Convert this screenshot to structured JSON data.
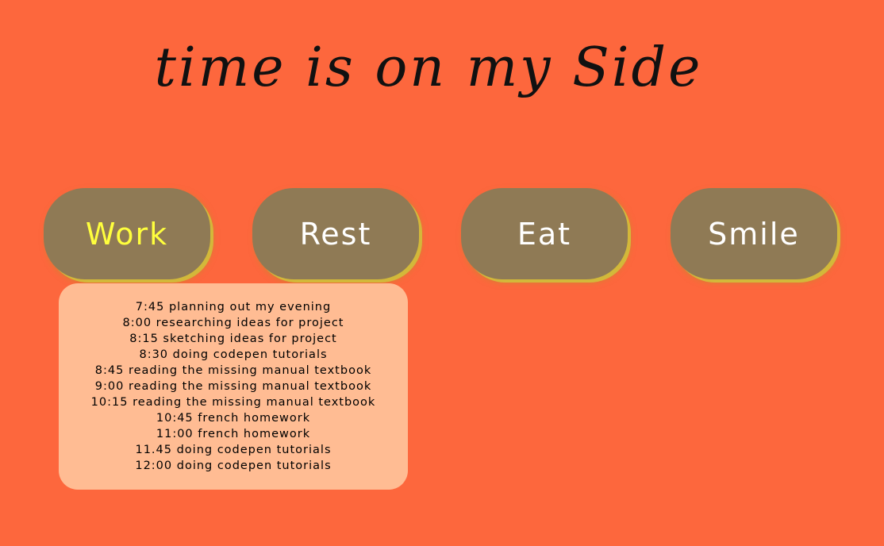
{
  "title": "time is on my Side",
  "tabs": [
    {
      "label": "Work",
      "active": true
    },
    {
      "label": "Rest",
      "active": false
    },
    {
      "label": "Eat",
      "active": false
    },
    {
      "label": "Smile",
      "active": false
    }
  ],
  "schedule": [
    "7:45 planning out my evening",
    "8:00 researching ideas for project",
    "8:15 sketching ideas for project",
    "8:30 doing codepen tutorials",
    "8:45 reading the missing manual textbook",
    "9:00 reading the missing manual textbook",
    "10:15 reading the missing manual textbook",
    "10:45 french homework",
    "11:00 french homework",
    "11.45 doing codepen tutorials",
    "12:00 doing codepen tutorials"
  ],
  "colors": {
    "background": "#fd673d",
    "tab_background": "#8f7a55",
    "tab_text": "#ffffff",
    "tab_active_text": "#ffff3d",
    "panel_background": "#ffbc93"
  }
}
